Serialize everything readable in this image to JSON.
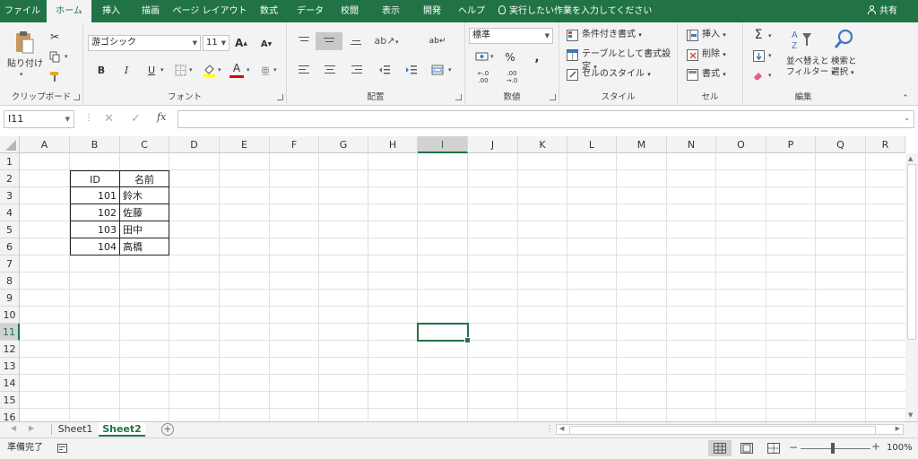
{
  "tabs": [
    "ファイル",
    "ホーム",
    "挿入",
    "描画",
    "ページ レイアウト",
    "数式",
    "データ",
    "校閲",
    "表示",
    "開発",
    "ヘルプ"
  ],
  "active_tab": "ホーム",
  "tell_me": "実行したい作業を入力してください",
  "share": "共有",
  "ribbon": {
    "clipboard": {
      "label": "クリップボード",
      "paste": "貼り付け"
    },
    "font": {
      "label": "フォント",
      "name": "游ゴシック",
      "size": "11",
      "bold": "B",
      "italic": "I",
      "underline": "U",
      "grow": "A",
      "shrink": "A",
      "font_color": "A",
      "font_color_bar": "#e00000"
    },
    "alignment": {
      "label": "配置"
    },
    "number": {
      "label": "数値",
      "format": "標準"
    },
    "styles": {
      "label": "スタイル",
      "conditional": "条件付き書式",
      "table": "テーブルとして書式設定",
      "cell_styles": "セルのスタイル"
    },
    "cells": {
      "label": "セル",
      "insert": "挿入",
      "delete": "削除",
      "format": "書式"
    },
    "editing": {
      "label": "編集",
      "sort_filter_1": "並べ替えと",
      "sort_filter_2": "フィルター",
      "find_1": "検索と",
      "find_2": "選択"
    }
  },
  "formula_bar": {
    "name_box": "I11",
    "fx": "fx",
    "content": ""
  },
  "columns": [
    "A",
    "B",
    "C",
    "D",
    "E",
    "F",
    "G",
    "H",
    "I",
    "J",
    "K",
    "L",
    "M",
    "N",
    "O",
    "P",
    "Q",
    "R"
  ],
  "rows": [
    "1",
    "2",
    "3",
    "4",
    "5",
    "6",
    "7",
    "8",
    "9",
    "10",
    "11",
    "12",
    "13",
    "14",
    "15",
    "16"
  ],
  "selected_cell": "I11",
  "table": {
    "header": [
      "ID",
      "名前"
    ],
    "rows": [
      [
        "101",
        "鈴木"
      ],
      [
        "102",
        "佐藤"
      ],
      [
        "103",
        "田中"
      ],
      [
        "104",
        "高橋"
      ]
    ]
  },
  "sheets": [
    "Sheet1",
    "Sheet2"
  ],
  "active_sheet": "Sheet2",
  "status": {
    "ready": "準備完了",
    "zoom": "100%"
  },
  "colors": {
    "accent": "#217346",
    "ribbon_bg": "#f3f3f3"
  }
}
